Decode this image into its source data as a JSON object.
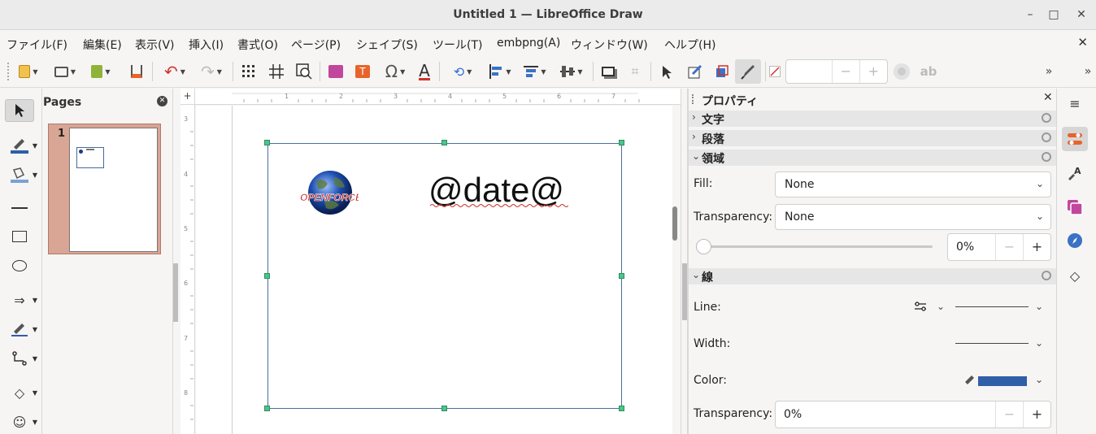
{
  "window": {
    "title": "Untitled 1 — LibreOffice Draw"
  },
  "menu": [
    "ファイル(F)",
    "編集(E)",
    "表示(V)",
    "挿入(I)",
    "書式(O)",
    "ページ(P)",
    "シェイプ(S)",
    "ツール(T)",
    "embpng(A)",
    "ウィンドウ(W)",
    "ヘルプ(H)"
  ],
  "pages_pane": {
    "title": "Pages",
    "page_number": "1"
  },
  "canvas": {
    "field_text": "@date@",
    "logo_text": "OPENFORCE"
  },
  "sidebar": {
    "title": "プロパティ",
    "sections": {
      "character": "文字",
      "paragraph": "段落",
      "area": "領域",
      "line": "線"
    },
    "area": {
      "fill_label": "Fill:",
      "fill_value": "None",
      "transparency_label": "Transparency:",
      "transparency_value": "None",
      "transparency_percent": "0%"
    },
    "line": {
      "line_label": "Line:",
      "width_label": "Width:",
      "color_label": "Color:",
      "transparency_label": "Transparency:",
      "transparency_value": "0%",
      "color": "#2f5fa7"
    }
  },
  "colors": {
    "accent_orange": "#e8632b",
    "selection_handle": "#4cc58a",
    "page_thumb_bg": "#d9a594"
  }
}
